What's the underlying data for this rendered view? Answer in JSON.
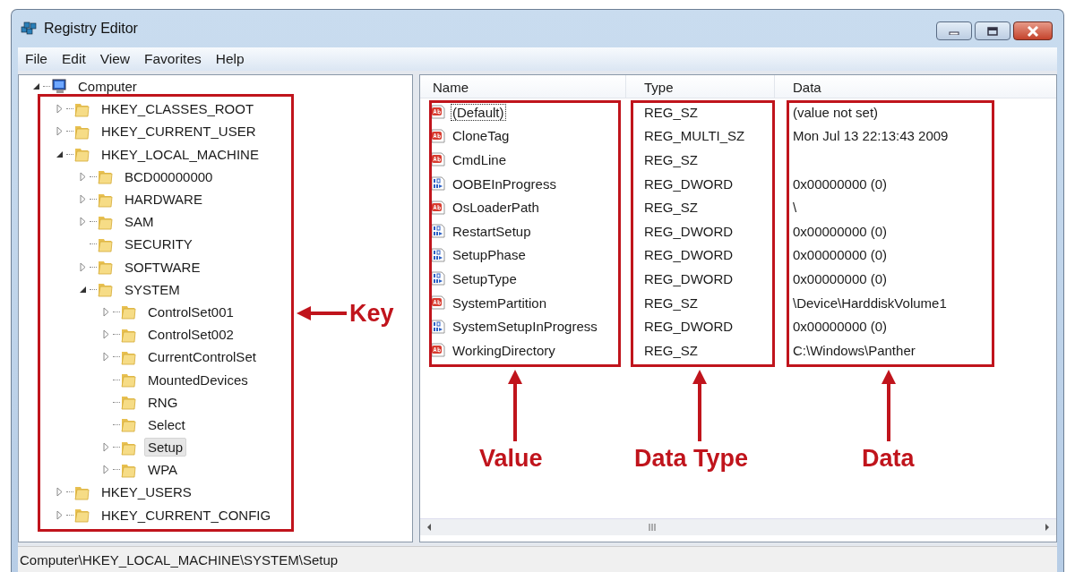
{
  "window": {
    "title": "Registry Editor"
  },
  "menu": [
    {
      "label": "File"
    },
    {
      "label": "Edit"
    },
    {
      "label": "View"
    },
    {
      "label": "Favorites"
    },
    {
      "label": "Help"
    }
  ],
  "tree": [
    {
      "label": "Computer",
      "expanded": true,
      "selected": false,
      "children": [
        {
          "label": "HKEY_CLASSES_ROOT",
          "expanded": false,
          "selected": false
        },
        {
          "label": "HKEY_CURRENT_USER",
          "expanded": false,
          "selected": false
        },
        {
          "label": "HKEY_LOCAL_MACHINE",
          "expanded": true,
          "selected": false,
          "children": [
            {
              "label": "BCD00000000",
              "expanded": false,
              "selected": false
            },
            {
              "label": "HARDWARE",
              "expanded": false,
              "selected": false
            },
            {
              "label": "SAM",
              "expanded": false,
              "selected": false
            },
            {
              "label": "SECURITY",
              "selected": false
            },
            {
              "label": "SOFTWARE",
              "expanded": false,
              "selected": false
            },
            {
              "label": "SYSTEM",
              "expanded": true,
              "selected": false,
              "children": [
                {
                  "label": "ControlSet001",
                  "expanded": false,
                  "selected": false
                },
                {
                  "label": "ControlSet002",
                  "expanded": false,
                  "selected": false
                },
                {
                  "label": "CurrentControlSet",
                  "expanded": false,
                  "selected": false
                },
                {
                  "label": "MountedDevices",
                  "selected": false
                },
                {
                  "label": "RNG",
                  "selected": false
                },
                {
                  "label": "Select",
                  "selected": false
                },
                {
                  "label": "Setup",
                  "expanded": false,
                  "selected": true
                },
                {
                  "label": "WPA",
                  "expanded": false,
                  "selected": false
                }
              ]
            }
          ]
        },
        {
          "label": "HKEY_USERS",
          "expanded": false,
          "selected": false
        },
        {
          "label": "HKEY_CURRENT_CONFIG",
          "expanded": false,
          "selected": false
        }
      ]
    }
  ],
  "columns": [
    "Name",
    "Type",
    "Data"
  ],
  "rows": [
    {
      "kind": "string",
      "name": "(Default)",
      "type": "REG_SZ",
      "data": "(value not set)",
      "focused": true
    },
    {
      "kind": "string",
      "name": "CloneTag",
      "type": "REG_MULTI_SZ",
      "data": "Mon Jul 13 22:13:43 2009",
      "focused": false
    },
    {
      "kind": "string",
      "name": "CmdLine",
      "type": "REG_SZ",
      "focused": false
    },
    {
      "kind": "binary",
      "name": "OOBEInProgress",
      "type": "REG_DWORD",
      "data": "0x00000000 (0)",
      "focused": false
    },
    {
      "kind": "string",
      "name": "OsLoaderPath",
      "type": "REG_SZ",
      "data": "\\",
      "focused": false
    },
    {
      "kind": "binary",
      "name": "RestartSetup",
      "type": "REG_DWORD",
      "data": "0x00000000 (0)",
      "focused": false
    },
    {
      "kind": "binary",
      "name": "SetupPhase",
      "type": "REG_DWORD",
      "data": "0x00000000 (0)",
      "focused": false
    },
    {
      "kind": "binary",
      "name": "SetupType",
      "type": "REG_DWORD",
      "data": "0x00000000 (0)",
      "focused": false
    },
    {
      "kind": "string",
      "name": "SystemPartition",
      "type": "REG_SZ",
      "data": "\\Device\\HarddiskVolume1",
      "focused": false
    },
    {
      "kind": "binary",
      "name": "SystemSetupInProgress",
      "type": "REG_DWORD",
      "data": "0x00000000 (0)",
      "focused": false
    },
    {
      "kind": "string",
      "name": "WorkingDirectory",
      "type": "REG_SZ",
      "data": "C:\\Windows\\Panther",
      "focused": false
    }
  ],
  "annotations": [
    {
      "kind": "side",
      "label": "Key"
    },
    {
      "kind": "below",
      "label": "Value"
    },
    {
      "kind": "below",
      "label": "Data Type"
    },
    {
      "kind": "below",
      "label": "Data"
    }
  ],
  "status_bar": "Computer\\HKEY_LOCAL_MACHINE\\SYSTEM\\Setup"
}
